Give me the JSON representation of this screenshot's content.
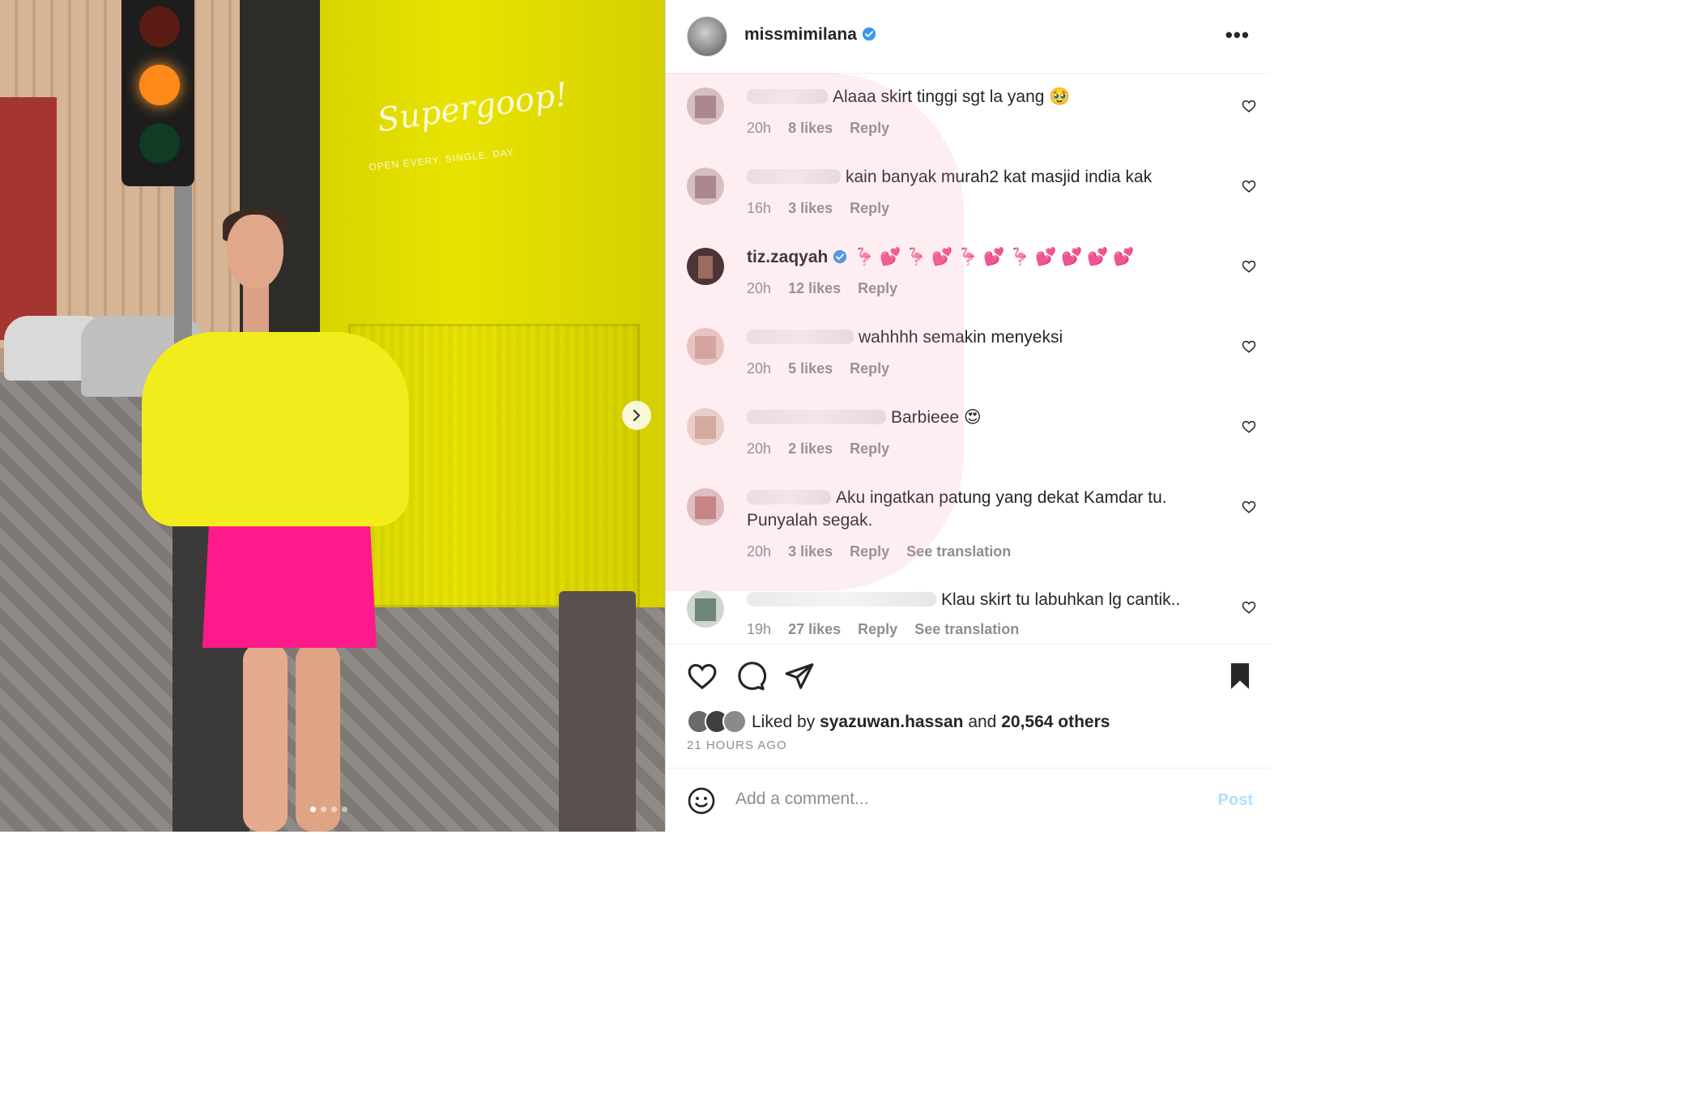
{
  "post": {
    "username": "missmimilana",
    "more_icon": "more-horizontal-icon"
  },
  "photo": {
    "brand_text": "Supergoop!",
    "brand_sub": "OPEN EVERY. SINGLE. DAY.",
    "slide_count": 4,
    "active_slide": 1
  },
  "comments": [
    {
      "user_visible": "",
      "text": "Alaaa skirt tinggi sgt la yang 🥹",
      "time": "20h",
      "likes": "8 likes",
      "reply": "Reply",
      "translate": ""
    },
    {
      "user_visible": "",
      "text": "kain banyak murah2 kat masjid india kak",
      "time": "16h",
      "likes": "3 likes",
      "reply": "Reply",
      "translate": ""
    },
    {
      "user_visible": "tiz.zaqyah",
      "text": "🦩 💕 🦩 💕 🦩 💕 🦩 💕 💕 💕 💕",
      "time": "20h",
      "likes": "12 likes",
      "reply": "Reply",
      "translate": ""
    },
    {
      "user_visible": "",
      "text": "wahhhh semakin menyeksi",
      "time": "20h",
      "likes": "5 likes",
      "reply": "Reply",
      "translate": ""
    },
    {
      "user_visible": "",
      "text": "Barbieee 😍",
      "time": "20h",
      "likes": "2 likes",
      "reply": "Reply",
      "translate": ""
    },
    {
      "user_visible": "",
      "text": "Aku ingatkan patung yang dekat Kamdar tu. Punyalah segak.",
      "time": "20h",
      "likes": "3 likes",
      "reply": "Reply",
      "translate": "See translation"
    },
    {
      "user_visible": "",
      "text": "Klau skirt tu labuhkan lg cantik..",
      "time": "19h",
      "likes": "27 likes",
      "reply": "Reply",
      "translate": "See translation"
    }
  ],
  "likes": {
    "prefix": "Liked by",
    "liker": "syazuwan.hassan",
    "and": "and",
    "others": "20,564 others"
  },
  "timestamp": "21 HOURS AGO",
  "add_comment": {
    "placeholder": "Add a comment...",
    "post_label": "Post"
  },
  "colors": {
    "accent": "#0095f6",
    "post_disabled": "#b2dffc",
    "muted": "#8e8e8e"
  }
}
